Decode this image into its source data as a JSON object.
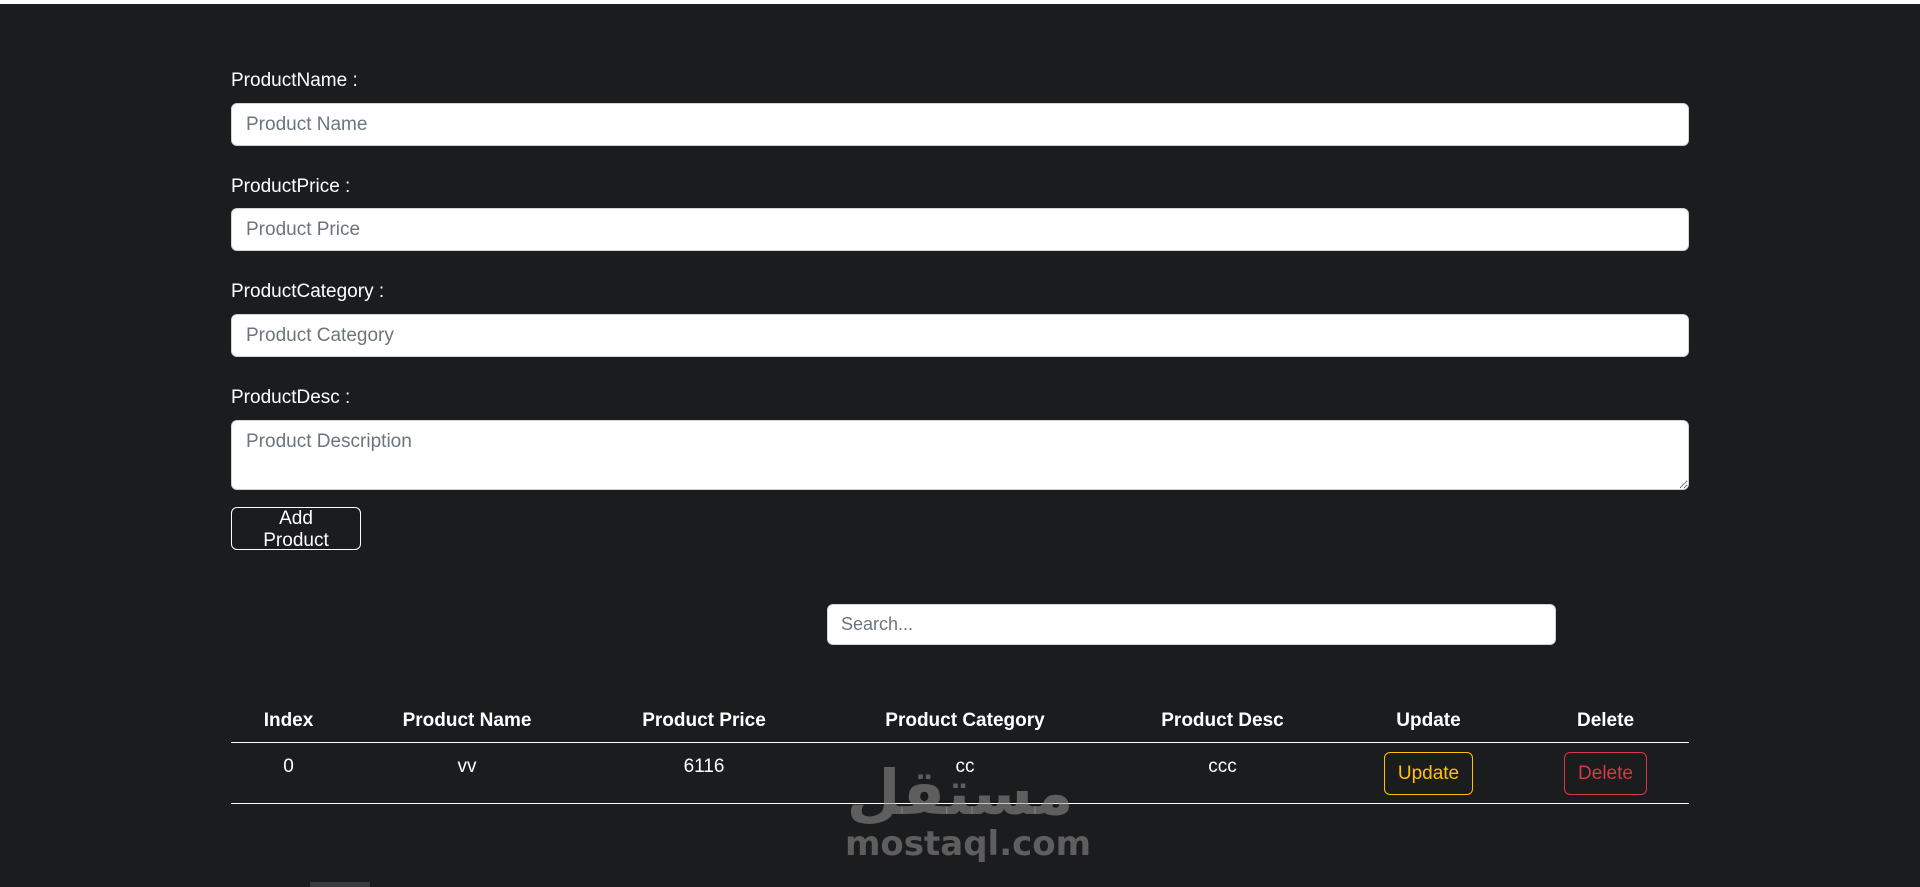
{
  "form": {
    "name_label": "ProductName :",
    "name_placeholder": "Product Name",
    "price_label": "ProductPrice :",
    "price_placeholder": "Product Price",
    "category_label": "ProductCategory :",
    "category_placeholder": "Product Category",
    "desc_label": "ProductDesc :",
    "desc_placeholder": "Product Description",
    "add_button": "Add Product"
  },
  "search": {
    "placeholder": "Search..."
  },
  "table": {
    "headers": [
      "Index",
      "Product Name",
      "Product Price",
      "Product Category",
      "Product Desc",
      "Update",
      "Delete"
    ],
    "rows": [
      {
        "index": "0",
        "name": "vv",
        "price": "6116",
        "category": "cc",
        "desc": "ccc",
        "update_label": "Update",
        "delete_label": "Delete"
      }
    ]
  },
  "watermark": {
    "logo": "مستقل",
    "text": "mostaql.com"
  },
  "colors": {
    "background": "#1b1c1e",
    "update": "#ffc107",
    "delete": "#dc3545"
  }
}
